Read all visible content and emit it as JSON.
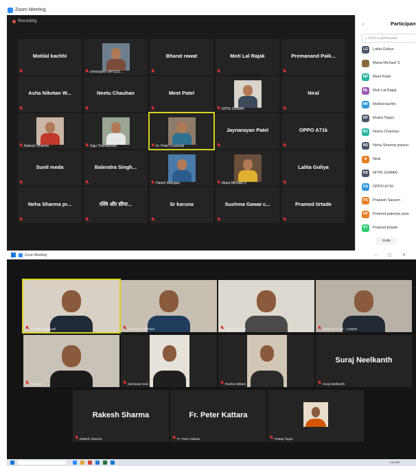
{
  "top_window": {
    "title": "Zoom Meeting",
    "recording_label": "Recording",
    "tiles": [
      {
        "name": "Motilal kachhi",
        "label": "",
        "video": false
      },
      {
        "name": "",
        "label": "christopher MPSSS ...",
        "video": true,
        "bg": "#6d7f8f",
        "shirt": "#7b4c3a"
      },
      {
        "name": "Bharat rawat",
        "label": "",
        "video": false
      },
      {
        "name": "Moti Lal Rajak",
        "label": "",
        "video": false
      },
      {
        "name": "Premanand  Paik...",
        "label": "",
        "video": false
      },
      {
        "name": "Asha Niketan W...",
        "label": "",
        "video": false
      },
      {
        "name": "Neetu Chauhan",
        "label": "",
        "video": false
      },
      {
        "name": "Meet Patel",
        "label": "",
        "video": false
      },
      {
        "name": "",
        "label": "NITIN SUMAN",
        "video": true,
        "bg": "#d9d4cc",
        "shirt": "#3d4a5c"
      },
      {
        "name": "Niral",
        "label": "",
        "video": false
      },
      {
        "name": "",
        "label": "Rakesh Sharma",
        "video": true,
        "bg": "#c9b6a6",
        "shirt": "#c0392b"
      },
      {
        "name": "",
        "label": "Saju Thannachan",
        "video": true,
        "bg": "#9aa596",
        "shirt": "#e8e8e8"
      },
      {
        "name": "",
        "label": "Fr. Peter Cracknell",
        "video": true,
        "bg": "#8e7c69",
        "shirt": "#2f6f8f",
        "active": true
      },
      {
        "name": "Jaynarayan Patel",
        "label": "",
        "video": false
      },
      {
        "name": "OPPO A71k",
        "label": "",
        "video": false
      },
      {
        "name": "Sunil meda",
        "label": "",
        "video": false
      },
      {
        "name": "Balendra  Singh...",
        "label": "",
        "video": false
      },
      {
        "name": "",
        "label": "Harish Mahajan",
        "video": true,
        "bg": "#4a7aa8",
        "shirt": "#2b5c8c"
      },
      {
        "name": "",
        "label": "Maria Michael S",
        "video": true,
        "bg": "#6a4f3b",
        "shirt": "#e0b030"
      },
      {
        "name": "Lalita Goliya",
        "label": "",
        "video": false
      },
      {
        "name": "Neha Sharma  pr...",
        "label": "",
        "video": false
      },
      {
        "name": "रश्मि और सीमा...",
        "label": "",
        "video": false
      },
      {
        "name": "Sr karuna",
        "label": "",
        "video": false
      },
      {
        "name": "Sushma  Gawai  c...",
        "label": "",
        "video": false
      },
      {
        "name": "Pramod tirtade",
        "label": "",
        "video": false
      }
    ],
    "participants_panel": {
      "title": "Participants",
      "search_placeholder": "Find a participant",
      "invite_label": "Invite",
      "list": [
        {
          "initials": "LG",
          "name": "Lalita Goliya",
          "color": "#4a5568"
        },
        {
          "initials": "",
          "name": "Maria Michael S",
          "color": "#8a6a40"
        },
        {
          "initials": "MP",
          "name": "Meet Patel",
          "color": "#2bb5a0"
        },
        {
          "initials": "ML",
          "name": "Moti Lal Rajak",
          "color": "#9b59b6"
        },
        {
          "initials": "MK",
          "name": "Motilal kachhi",
          "color": "#3498db"
        },
        {
          "initials": "MT",
          "name": "Mukta Toppo",
          "color": "#4a5568"
        },
        {
          "initials": "NC",
          "name": "Neetu Chauhan",
          "color": "#2bb5a0"
        },
        {
          "initials": "NS",
          "name": "Neha Sharma prasoo",
          "color": "#4a5568"
        },
        {
          "initials": "N",
          "name": "Niral",
          "color": "#e67e22"
        },
        {
          "initials": "NS",
          "name": "NITIN SUMAN",
          "color": "#4a5568"
        },
        {
          "initials": "OA",
          "name": "OPPO A71K",
          "color": "#3498db"
        },
        {
          "initials": "PS",
          "name": "Prakash Saiyam",
          "color": "#e67e22"
        },
        {
          "initials": "PP",
          "name": "Pramod pateriya pras",
          "color": "#e67e22"
        },
        {
          "initials": "PT",
          "name": "Pramod tirtade",
          "color": "#2ecc71"
        }
      ]
    }
  },
  "bottom_window": {
    "title": "Zoom Meeting",
    "tiles": [
      {
        "name": "",
        "label": "Fr. Peter Cracknell",
        "video": true,
        "bg": "#d8d0c4",
        "shirt": "#1f2a36",
        "active": true
      },
      {
        "name": "",
        "label": "christopher MPSSS",
        "video": true,
        "bg": "#c7bfb2",
        "shirt": "#1f3c5c"
      },
      {
        "name": "",
        "label": "Saju T. CrasbR",
        "video": true,
        "bg": "#ded9d0",
        "shirt": "#4a4a4a"
      },
      {
        "name": "",
        "label": "Balendra Singh - CrasbR",
        "video": true,
        "bg": "#b8b2a6",
        "shirt": "#222a33"
      },
      {
        "name": "",
        "label": "nabtaha",
        "video": true,
        "bg": "#c9c2b6",
        "shirt": "#1a1a1a"
      },
      {
        "name": "",
        "label": "Zacharias Nani",
        "video": true,
        "bg": "#e6e2da",
        "shirt": "#1f1f1f"
      },
      {
        "name": "",
        "label": "Rashmi Bilkare",
        "video": true,
        "bg": "#d2c6b6",
        "shirt": "#2a2a2a"
      },
      {
        "name": "Suraj Neelkanth",
        "label": "Suraj Neelkanth",
        "video": false
      },
      {
        "name": "Rakesh Sharma",
        "label": "Rakesh Sharma",
        "video": false
      },
      {
        "name": "Fr. Peter Kattara",
        "label": "Fr. Peter Kattara",
        "video": false
      },
      {
        "name": "",
        "label": "Pratap Toppo",
        "video": true,
        "bg": "#e8dccb",
        "shirt": "#d35400"
      }
    ],
    "taskbar": {
      "clock": "2:16 PM"
    }
  }
}
